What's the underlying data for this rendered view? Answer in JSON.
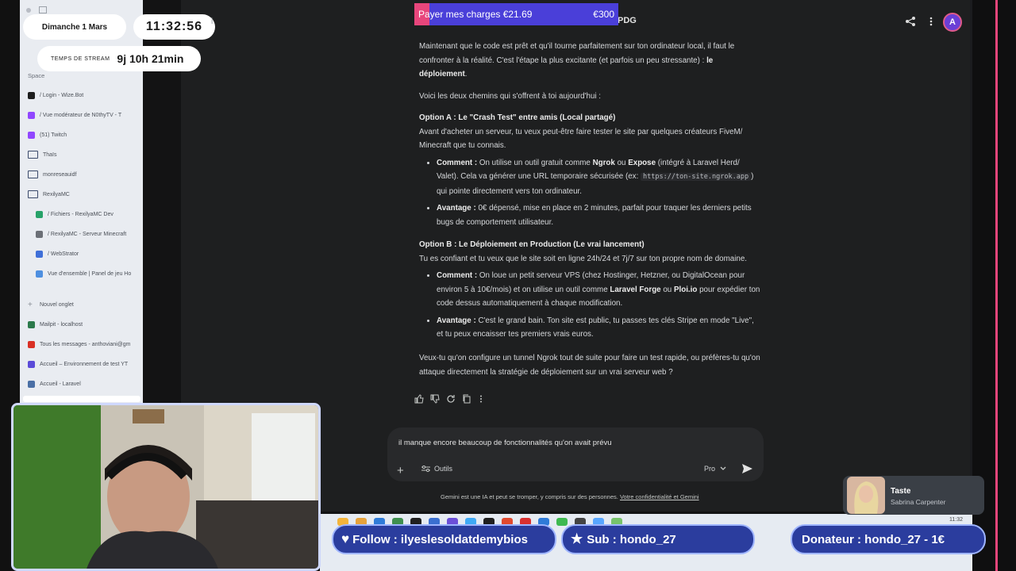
{
  "overlay": {
    "date": "Dimanche 1 Mars",
    "time": "11:32:56",
    "stream_label": "TEMPS DE STREAM",
    "stream_time": "9j 10h 21min",
    "charges_label": "Payer mes charges €21.69",
    "charges_goal": "€300",
    "charges_progress": 0.0723,
    "follow": "Follow : ilyeslesoldatdemybios",
    "sub": "Sub : hondo_27",
    "donator": "Donateur : hondo_27 - 1€",
    "music_title": "Taste",
    "music_artist": "Sabrina Carpenter"
  },
  "sidebar": {
    "space_label": "Space",
    "items": [
      {
        "label": "/  Login - Wize.Bot",
        "icon": "wizebot-icon",
        "color": "#1d1d1d"
      },
      {
        "label": "/  Vue modérateur de N0thyTV - T",
        "icon": "twitch-icon",
        "color": "#9147ff"
      },
      {
        "label": "(51) Twitch",
        "icon": "twitch-icon",
        "color": "#9147ff"
      },
      {
        "label": "Thaïs",
        "icon": "folder-icon",
        "color": "#3b4a6b"
      },
      {
        "label": "monreseauidf",
        "icon": "folder-icon",
        "color": "#3b4a6b"
      },
      {
        "label": "RexilyaMC",
        "icon": "folder-open-icon",
        "color": "#3b4a6b"
      },
      {
        "label": "/  Fichiers - RexilyaMC Dev",
        "icon": "s-icon",
        "color": "#27a269"
      },
      {
        "label": "/  RexilyaMC - Serveur Minecraft",
        "icon": "server-icon",
        "color": "#6b6f76"
      },
      {
        "label": "/  WebStrator",
        "icon": "webstrator-icon",
        "color": "#3f6fd8"
      },
      {
        "label": "Vue d'ensemble | Panel de jeu Ho",
        "icon": "cloud-icon",
        "color": "#4e8fe0"
      },
      {
        "label": "Nouvel onglet",
        "icon": "plus-icon",
        "color": "#8a8f96"
      },
      {
        "label": "Mailpit - localhost",
        "icon": "mailpit-icon",
        "color": "#2c7a4b"
      },
      {
        "label": "Tous les messages - anthoviani@gm",
        "icon": "gmail-icon",
        "color": "#d93025"
      },
      {
        "label": "Accueil – Environnement de test YT",
        "icon": "app-icon",
        "color": "#5b4bd8"
      },
      {
        "label": "Accueil - Laravel",
        "icon": "laravel-icon",
        "color": "#4a6fa5"
      }
    ]
  },
  "header": {
    "title_fragment": "PDG",
    "avatar_letter": "A"
  },
  "chat": {
    "p1_a": "Maintenant que le code est prêt et qu'il tourne parfaitement sur ton ordinateur local, il faut le confronter à la réalité. C'est l'étape la plus excitante (et parfois un peu stressante) : ",
    "p1_b": "le déploiement",
    "p1_c": ".",
    "p2": "Voici les deux chemins qui s'offrent à toi aujourd'hui :",
    "optA_title": "Option A : Le \"Crash Test\" entre amis (Local partagé)",
    "optA_text": "Avant d'acheter un serveur, tu veux peut-être faire tester le site par quelques créateurs FiveM/ Minecraft que tu connais.",
    "a1_label": "Comment :",
    "a1_t1": " On utilise un outil gratuit comme ",
    "a1_b1": "Ngrok",
    "a1_t2": " ou ",
    "a1_b2": "Expose",
    "a1_t3": " (intégré à Laravel Herd/ Valet). Cela va générer une URL temporaire sécurisée (ex: ",
    "a1_code": "https://ton-site.ngrok.app",
    "a1_t4": ") qui pointe directement vers ton ordinateur.",
    "a2_label": "Avantage :",
    "a2_text": " 0€ dépensé, mise en place en 2 minutes, parfait pour traquer les derniers petits bugs de comportement utilisateur.",
    "optB_title": "Option B : Le Déploiement en Production (Le vrai lancement)",
    "optB_text": "Tu es confiant et tu veux que le site soit en ligne 24h/24 et 7j/7 sur ton propre nom de domaine.",
    "b1_label": "Comment :",
    "b1_t1": " On loue un petit serveur VPS (chez Hostinger, Hetzner, ou DigitalOcean pour environ 5 à 10€/mois) et on utilise un outil comme ",
    "b1_b1": "Laravel Forge",
    "b1_t2": " ou ",
    "b1_b2": "Ploi.io",
    "b1_t3": " pour expédier ton code dessus automatiquement à chaque modification.",
    "b2_label": "Avantage :",
    "b2_text": " C'est le grand bain. Ton site est public, tu passes tes clés Stripe en mode \"Live\", et tu peux encaisser tes premiers vrais euros.",
    "closing": "Veux-tu qu'on configure un tunnel Ngrok tout de suite pour faire un test rapide, ou préfères-tu qu'on attaque directement la stratégie de déploiement sur un vrai serveur web ?"
  },
  "input": {
    "value": "il manque encore beaucoup de fonctionnalités qu'on avait prévu",
    "tools_label": "Outils",
    "model_label": "Pro"
  },
  "footer": {
    "disclaimer": "Gemini est une IA et peut se tromper, y compris sur des personnes.",
    "link": "Votre confidentialité et Gemini"
  },
  "taskbar": {
    "clock": "11:32"
  },
  "colors": {
    "accent_pink": "#e8467c",
    "banner_blue": "#2b3d9e",
    "avatar_purple": "#6a3fd6"
  }
}
